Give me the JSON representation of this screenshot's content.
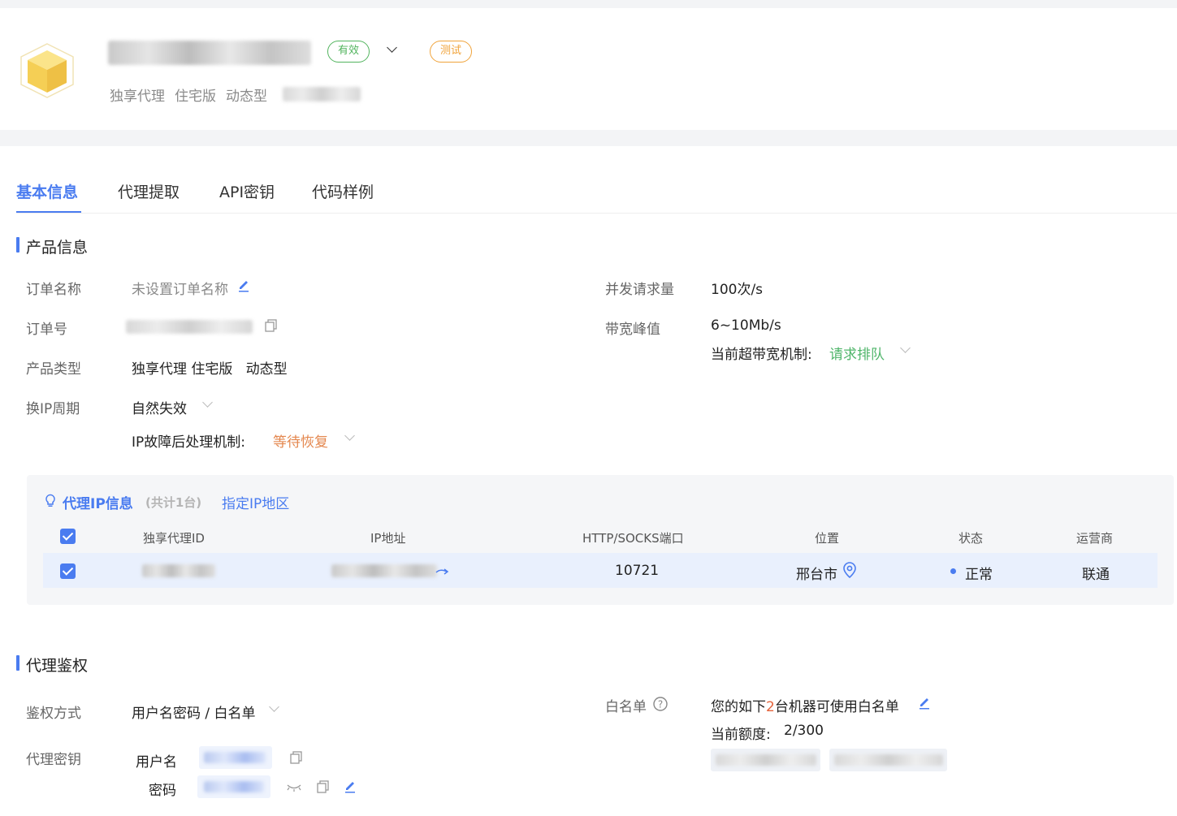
{
  "header": {
    "status_tag": "有效",
    "test_tag": "测试",
    "product_type_parts": [
      "独享代理",
      "住宅版",
      "动态型"
    ]
  },
  "tabs": [
    {
      "label": "基本信息",
      "active": true
    },
    {
      "label": "代理提取",
      "active": false
    },
    {
      "label": "API密钥",
      "active": false
    },
    {
      "label": "代码样例",
      "active": false
    }
  ],
  "product_info": {
    "section_title": "产品信息",
    "order_name_label": "订单名称",
    "order_name_value": "未设置订单名称",
    "order_no_label": "订单号",
    "product_type_label": "产品类型",
    "product_type_value": "独享代理 住宅版   动态型",
    "ip_cycle_label": "换IP周期",
    "ip_cycle_value": "自然失效",
    "ip_fault_label": "IP故障后处理机制:",
    "ip_fault_value": "等待恢复",
    "concurrency_label": "并发请求量",
    "concurrency_value": "100次/s",
    "bandwidth_label": "带宽峰值",
    "bandwidth_value": "6~10Mb/s",
    "over_bandwidth_label": "当前超带宽机制:",
    "over_bandwidth_value": "请求排队"
  },
  "proxy_ip": {
    "title": "代理IP信息",
    "count_text": "(共计1台)",
    "assign_link": "指定IP地区",
    "columns": [
      "独享代理ID",
      "IP地址",
      "HTTP/SOCKS端口",
      "位置",
      "状态",
      "运营商"
    ],
    "rows": [
      {
        "port": "10721",
        "location": "邢台市",
        "status": "正常",
        "isp": "联通"
      }
    ]
  },
  "auth": {
    "section_title": "代理鉴权",
    "method_label": "鉴权方式",
    "method_value": "用户名密码 / 白名单",
    "key_label": "代理密钥",
    "username_label": "用户名",
    "password_label": "密码",
    "whitelist_label": "白名单",
    "whitelist_prefix": "您的如下",
    "whitelist_count": "2",
    "whitelist_suffix": "台机器可使用白名单",
    "quota_label": "当前额度:",
    "quota_value": "2/300"
  },
  "colors": {
    "accent": "#4a7cf0",
    "valid_green": "#52b45e",
    "test_orange": "#f0a33a",
    "queue_green": "#4fb56a",
    "wait_orange": "#e4874e"
  }
}
